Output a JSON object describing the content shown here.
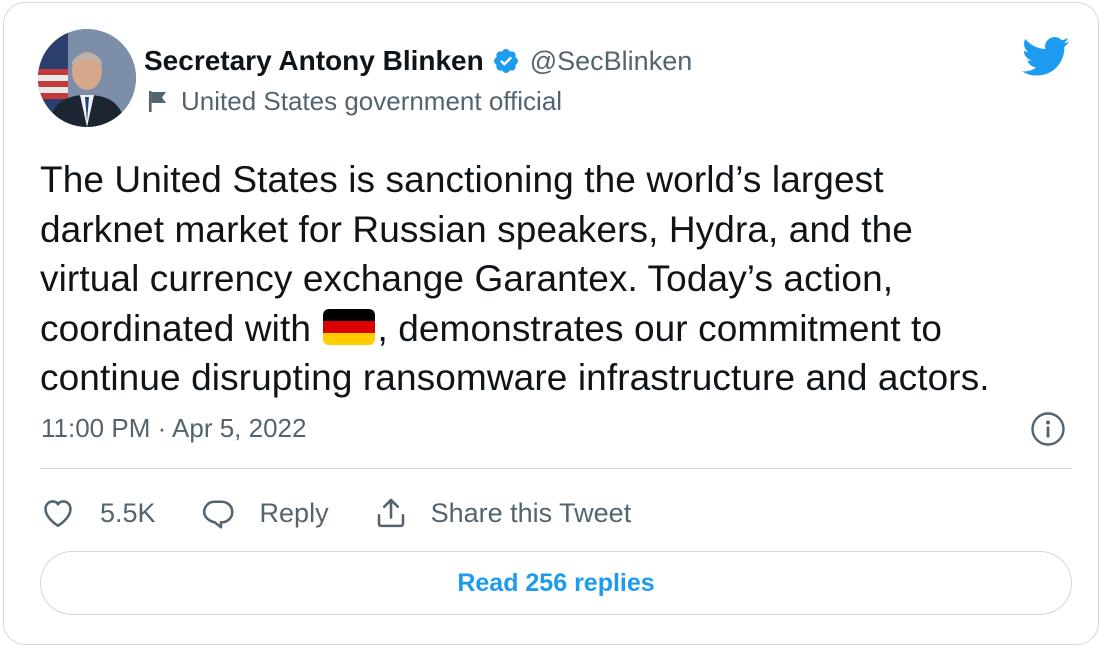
{
  "author": {
    "display_name": "Secretary Antony Blinken",
    "handle": "@SecBlinken",
    "label": "United States government official",
    "avatar_icon": "portrait-photo",
    "verified_icon": "verified-badge-icon"
  },
  "tweet": {
    "line1": "The United States is sanctioning the world’s largest",
    "line2": "darknet market for Russian speakers, Hydra, and the",
    "line3": "virtual currency exchange Garantex. Today’s action,",
    "line4_before_flag": "coordinated with ",
    "flag_emoji": "germany-flag",
    "line4_after_flag": ", demonstrates our commitment to",
    "line5": "continue disrupting ransomware infrastructure and actors.",
    "timestamp": "11:00 PM · Apr 5, 2022"
  },
  "actions": {
    "likes_count": "5.5K",
    "reply_label": "Reply",
    "share_label": "Share this Tweet"
  },
  "footer": {
    "read_replies_label": "Read 256 replies"
  },
  "colors": {
    "accent": "#1d9bf0",
    "secondary_text": "#536471",
    "border": "#cfd9de"
  }
}
